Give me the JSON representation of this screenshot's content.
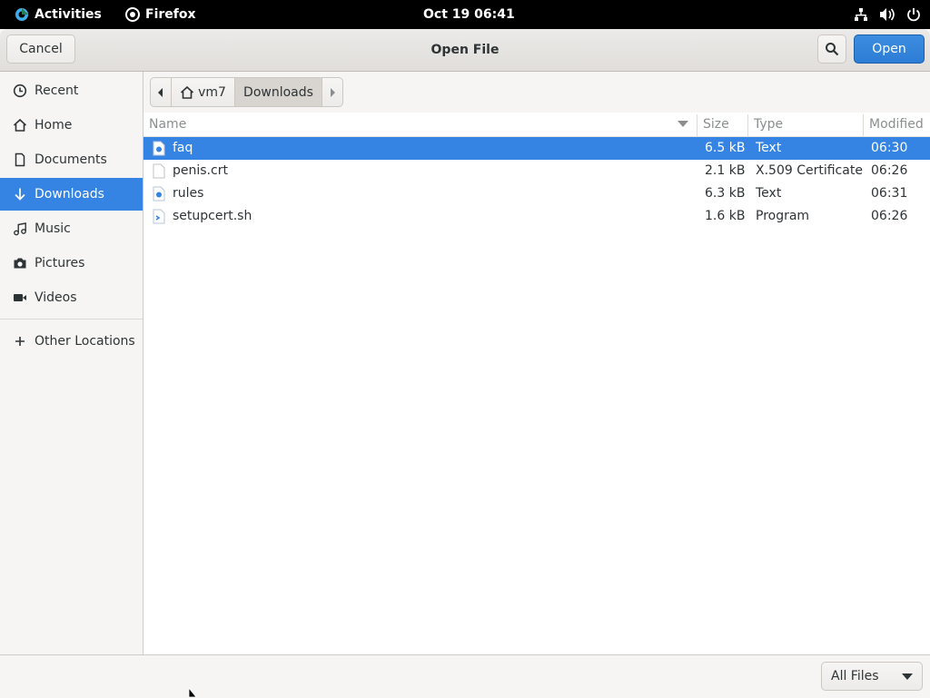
{
  "topbar": {
    "activities": "Activities",
    "app_name": "Firefox",
    "clock": "Oct 19  06:41",
    "icons": [
      "network-icon",
      "volume-icon",
      "power-icon"
    ]
  },
  "dialog": {
    "title": "Open File",
    "cancel_label": "Cancel",
    "open_label": "Open",
    "accent_color": "#3584e4"
  },
  "sidebar": {
    "items": [
      {
        "label": "Recent",
        "icon": "clock-icon"
      },
      {
        "label": "Home",
        "icon": "home-icon"
      },
      {
        "label": "Documents",
        "icon": "document-icon"
      },
      {
        "label": "Downloads",
        "icon": "download-icon",
        "selected": true
      },
      {
        "label": "Music",
        "icon": "music-icon"
      },
      {
        "label": "Pictures",
        "icon": "camera-icon"
      },
      {
        "label": "Videos",
        "icon": "video-icon"
      }
    ],
    "other_locations": "Other Locations"
  },
  "pathbar": {
    "home": "vm7",
    "current": "Downloads"
  },
  "filelist": {
    "columns": [
      "Name",
      "Size",
      "Type",
      "Modified"
    ],
    "rows": [
      {
        "name": "faq",
        "size": "6.5 kB",
        "type": "Text",
        "modified": "06:30",
        "icon": "text-file-icon",
        "selected": true
      },
      {
        "name": "penis.crt",
        "size": "2.1 kB",
        "type": "X.509 Certificate",
        "modified": "06:26",
        "icon": "generic-file-icon"
      },
      {
        "name": "rules",
        "size": "6.3 kB",
        "type": "Text",
        "modified": "06:31",
        "icon": "text-file-icon"
      },
      {
        "name": "setupcert.sh",
        "size": "1.6 kB",
        "type": "Program",
        "modified": "06:26",
        "icon": "script-file-icon"
      }
    ]
  },
  "filter": {
    "selected": "All Files"
  }
}
